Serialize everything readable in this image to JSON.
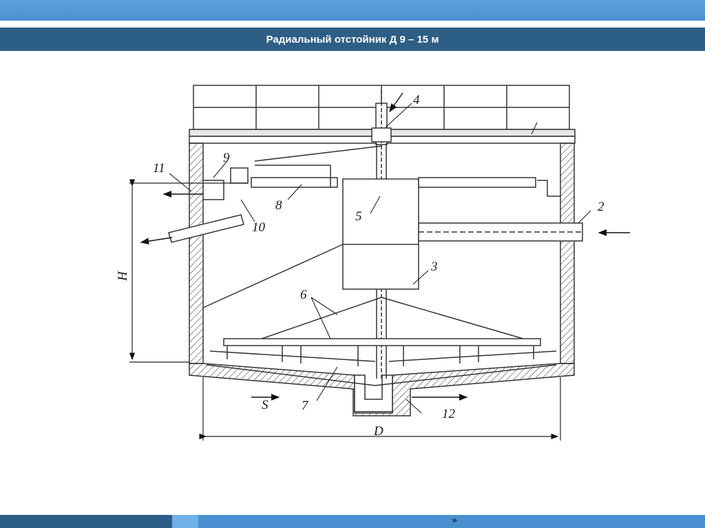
{
  "slide": {
    "title": "Радиальный отстойник Д 9 – 15 м"
  },
  "diagram": {
    "labels": {
      "n1": "",
      "n2": "2",
      "n3": "3",
      "n4": "4",
      "n5": "5",
      "n6": "6",
      "n7": "7",
      "n8": "8",
      "n9": "9",
      "n10": "10",
      "n11": "11",
      "n12": "12",
      "h": "H",
      "s": "S",
      "d": "D"
    }
  },
  "footer": {
    "nav_next": "»"
  }
}
